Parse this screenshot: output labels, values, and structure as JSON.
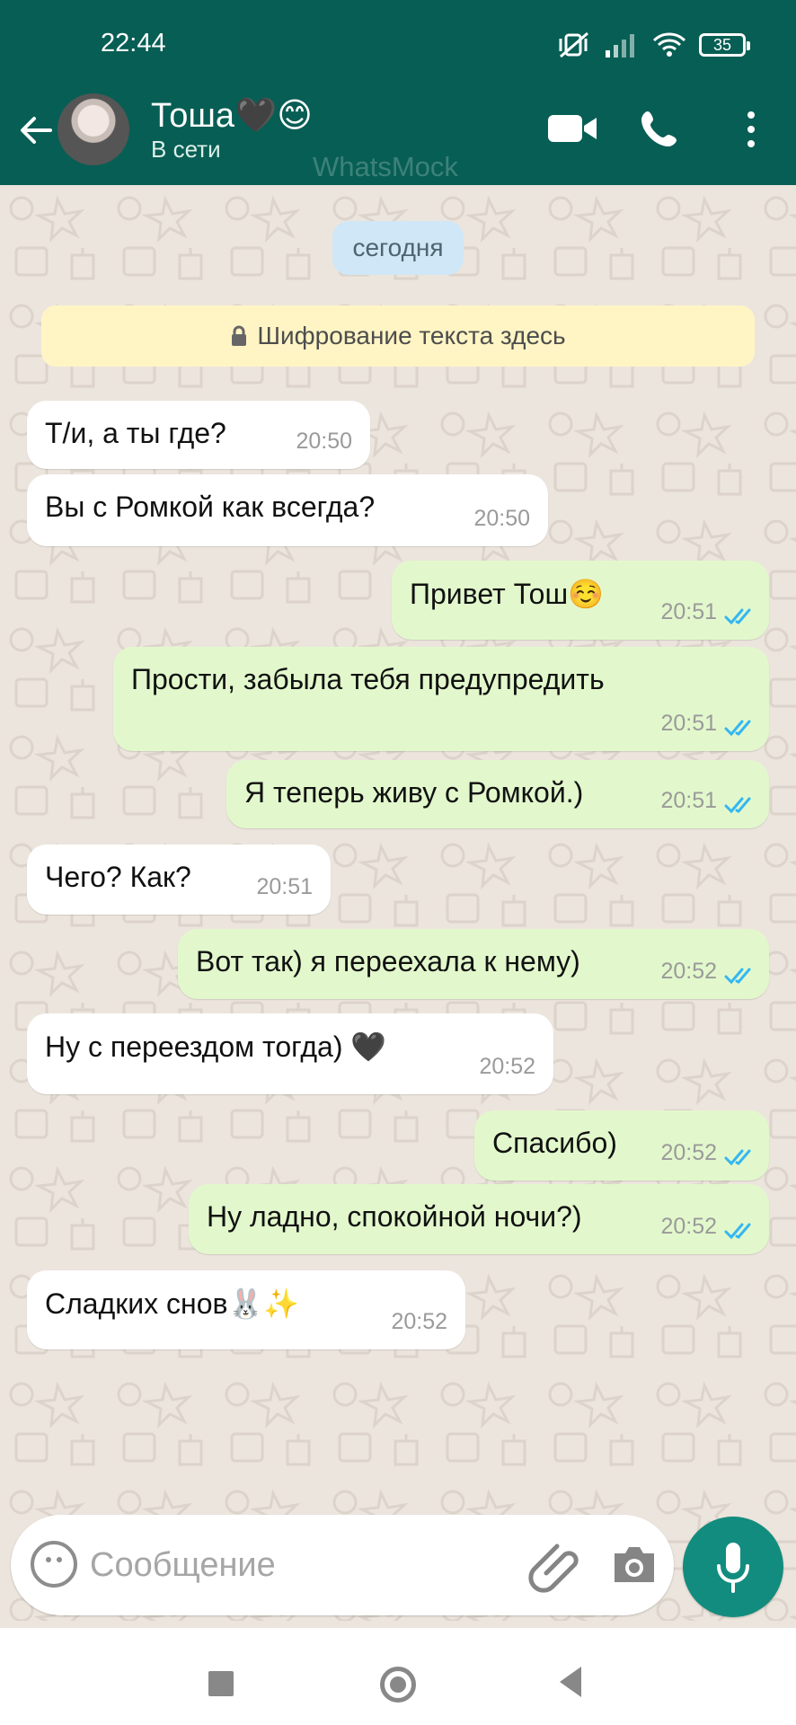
{
  "status_bar": {
    "time": "22:44",
    "battery": "35"
  },
  "header": {
    "contact_name": "Тоша🖤😊",
    "contact_status": "В сети",
    "watermark": "WhatsMock",
    "icons": [
      "back-arrow-icon",
      "video-call-icon",
      "phone-icon",
      "more-vert-icon"
    ]
  },
  "chat": {
    "date_label": "сегодня",
    "encryption_notice": "Шифрование текста здесь",
    "messages": [
      {
        "direction": "in",
        "text": "Т/и, а ты где?",
        "time": "20:50"
      },
      {
        "direction": "in",
        "text": "Вы с Ромкой как всегда?",
        "time": "20:50"
      },
      {
        "direction": "out",
        "text": "Привет Тош☺️",
        "time": "20:51",
        "read": true
      },
      {
        "direction": "out",
        "text": "Прости, забыла тебя предупредить",
        "time": "20:51",
        "read": true
      },
      {
        "direction": "out",
        "text": "Я теперь живу с Ромкой.)",
        "time": "20:51",
        "read": true
      },
      {
        "direction": "in",
        "text": "Чего? Как?",
        "time": "20:51"
      },
      {
        "direction": "out",
        "text": "Вот так) я переехала к нему)",
        "time": "20:52",
        "read": true
      },
      {
        "direction": "in",
        "text": "Ну с переездом тогда) 🖤",
        "time": "20:52"
      },
      {
        "direction": "out",
        "text": "Спасибо)",
        "time": "20:52",
        "read": true
      },
      {
        "direction": "out",
        "text": "Ну ладно, спокойной ночи?)",
        "time": "20:52",
        "read": true
      },
      {
        "direction": "in",
        "text": "Сладких снов🐰✨",
        "time": "20:52"
      }
    ]
  },
  "composer": {
    "placeholder": "Сообщение"
  },
  "colors": {
    "header": "#075e54",
    "incoming_bubble": "#ffffff",
    "outgoing_bubble": "#e2f8cc",
    "read_ticks": "#34b7f1",
    "mic_button": "#128c7e"
  }
}
